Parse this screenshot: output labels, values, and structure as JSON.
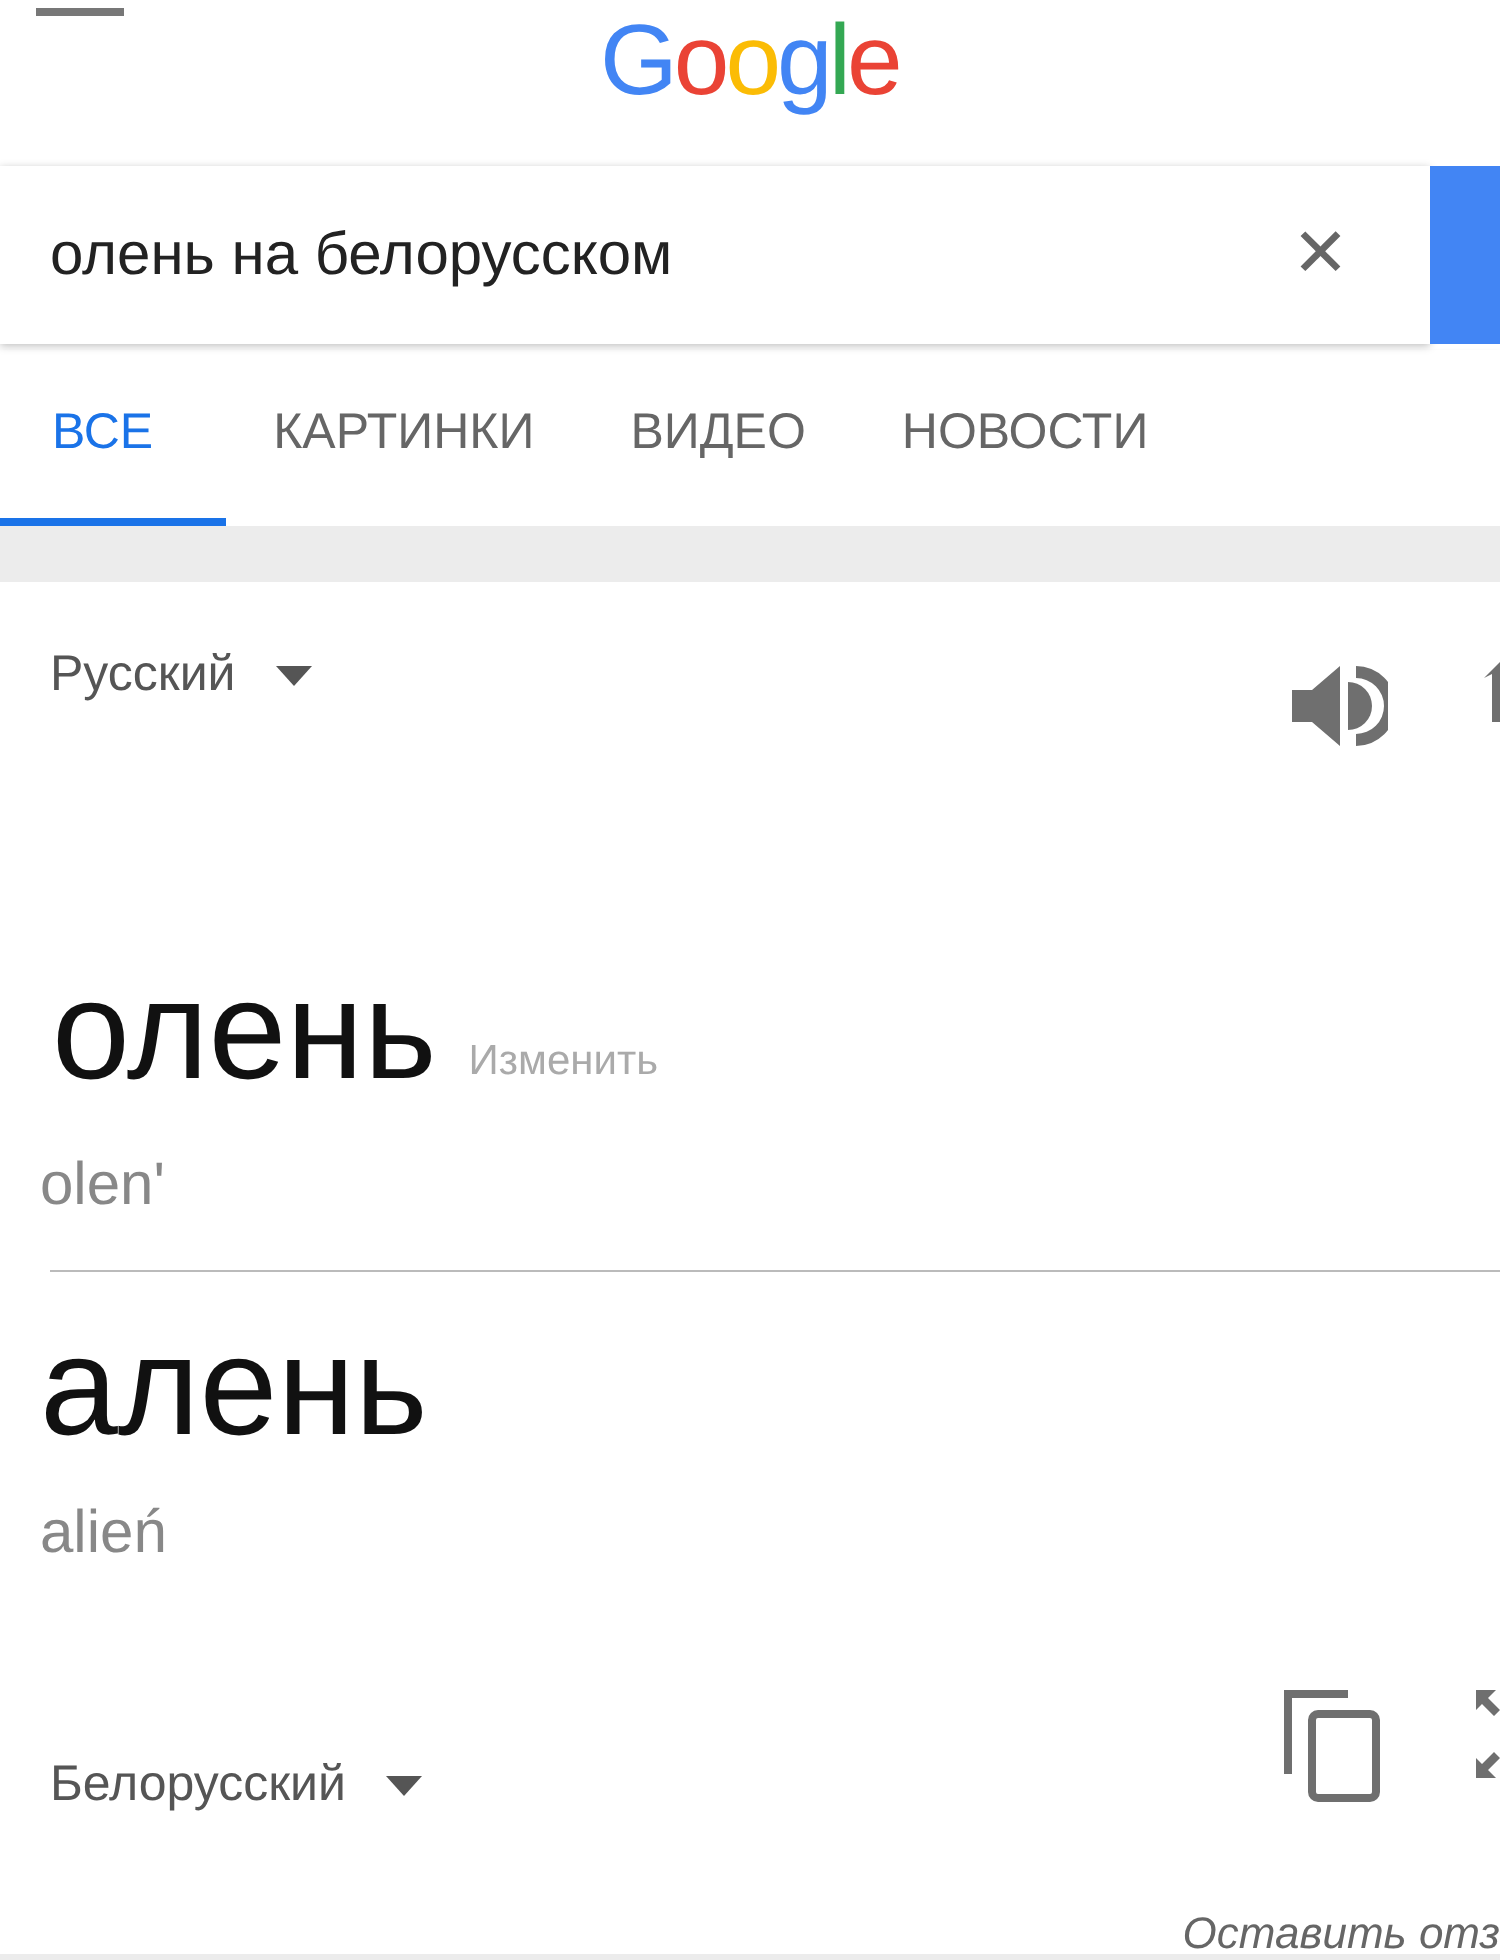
{
  "header": {
    "logo": "Google"
  },
  "search": {
    "value": "олень на белорусском",
    "clear": "✕"
  },
  "tabs": [
    {
      "label": "ВСЕ",
      "selected": true
    },
    {
      "label": "КАРТИНКИ",
      "selected": false
    },
    {
      "label": "ВИДЕО",
      "selected": false
    },
    {
      "label": "НОВОСТИ",
      "selected": false
    }
  ],
  "translator": {
    "source_language": "Русский",
    "source_word": "олень",
    "edit_link": "Изменить",
    "source_transliteration": "olen'",
    "target_word": "алень",
    "target_transliteration": "alień",
    "target_language": "Белорусский",
    "feedback": "Оставить отз"
  }
}
